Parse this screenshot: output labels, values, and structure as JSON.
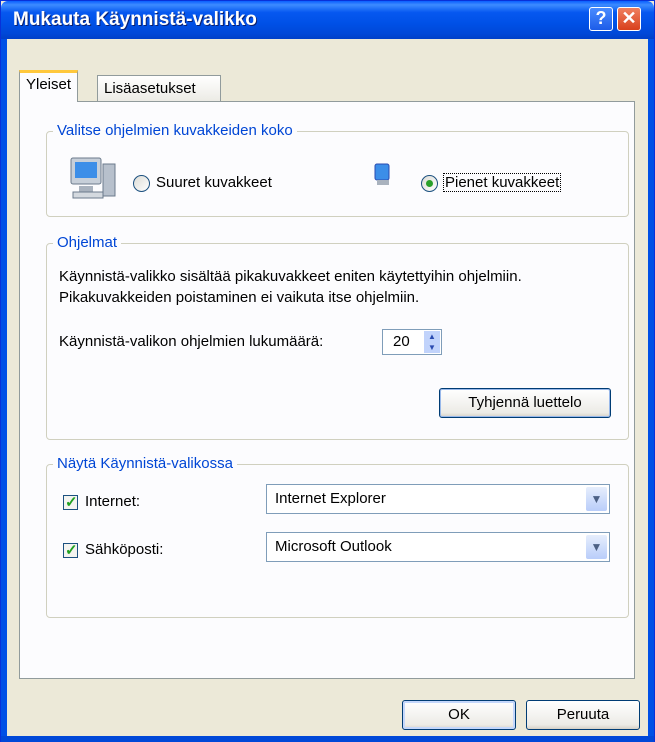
{
  "window": {
    "title": "Mukauta Käynnistä-valikko",
    "help_icon": "question-mark-icon",
    "close_icon": "close-x-icon"
  },
  "tabs": [
    {
      "label": "Yleiset",
      "active": true
    },
    {
      "label": "Lisäasetukset",
      "active": false
    }
  ],
  "icon_size_group": {
    "legend": "Valitse ohjelmien kuvakkeiden koko",
    "large_label": "Suuret kuvakkeet",
    "large_selected": false,
    "small_label": "Pienet kuvakkeet",
    "small_selected": true
  },
  "programs_group": {
    "legend": "Ohjelmat",
    "description_line1": "Käynnistä-valikko sisältää pikakuvakkeet eniten käytettyihin ohjelmiin.",
    "description_line2": "Pikakuvakkeiden poistaminen ei vaikuta itse ohjelmiin.",
    "count_label": "Käynnistä-valikon ohjelmien lukumäärä:",
    "count_value": "20",
    "clear_button": "Tyhjennä luettelo"
  },
  "show_group": {
    "legend": "Näytä Käynnistä-valikossa",
    "internet_label": "Internet:",
    "internet_checked": true,
    "internet_value": "Internet Explorer",
    "email_label": "Sähköposti:",
    "email_checked": true,
    "email_value": "Microsoft Outlook"
  },
  "buttons": {
    "ok": "OK",
    "cancel": "Peruuta"
  },
  "colors": {
    "title_bar": "#0050e6",
    "dialog_bg": "#ece9d8",
    "group_title": "#0046d5",
    "check": "#21a121"
  }
}
